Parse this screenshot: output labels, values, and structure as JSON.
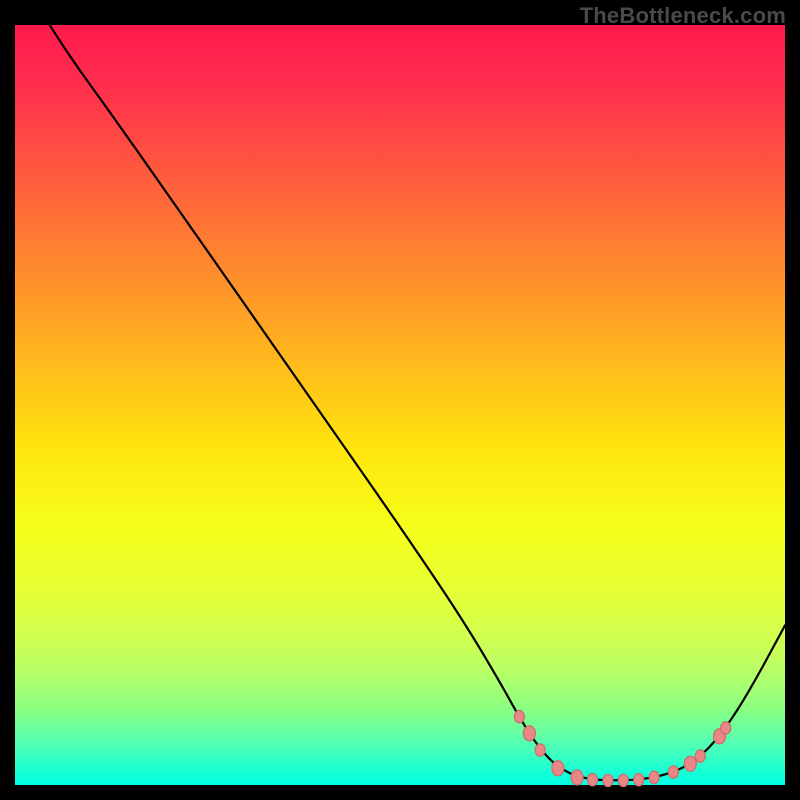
{
  "watermark": "TheBottleneck.com",
  "chart_data": {
    "type": "line",
    "title": "",
    "xlabel": "",
    "ylabel": "",
    "xlim": [
      0,
      100
    ],
    "ylim": [
      0,
      100
    ],
    "curve": [
      {
        "x": 4.5,
        "y": 100
      },
      {
        "x": 7.0,
        "y": 96
      },
      {
        "x": 12.0,
        "y": 89
      },
      {
        "x": 20.0,
        "y": 77.5
      },
      {
        "x": 30.0,
        "y": 63.0
      },
      {
        "x": 40.0,
        "y": 48.5
      },
      {
        "x": 50.0,
        "y": 34.0
      },
      {
        "x": 58.0,
        "y": 22.0
      },
      {
        "x": 63.0,
        "y": 13.5
      },
      {
        "x": 66.0,
        "y": 8.0
      },
      {
        "x": 69.0,
        "y": 3.6
      },
      {
        "x": 72.0,
        "y": 1.4
      },
      {
        "x": 75.0,
        "y": 0.7
      },
      {
        "x": 78.0,
        "y": 0.6
      },
      {
        "x": 81.0,
        "y": 0.7
      },
      {
        "x": 84.0,
        "y": 1.2
      },
      {
        "x": 87.0,
        "y": 2.3
      },
      {
        "x": 90.0,
        "y": 4.6
      },
      {
        "x": 93.0,
        "y": 8.5
      },
      {
        "x": 96.0,
        "y": 13.5
      },
      {
        "x": 100.0,
        "y": 21.0
      }
    ],
    "markers": [
      {
        "x": 65.5,
        "y": 9.0,
        "size": 5
      },
      {
        "x": 66.8,
        "y": 6.8,
        "size": 6
      },
      {
        "x": 68.2,
        "y": 4.6,
        "size": 5
      },
      {
        "x": 70.5,
        "y": 2.2,
        "size": 6
      },
      {
        "x": 73.0,
        "y": 1.0,
        "size": 6
      },
      {
        "x": 75.0,
        "y": 0.7,
        "size": 5
      },
      {
        "x": 77.0,
        "y": 0.6,
        "size": 5
      },
      {
        "x": 79.0,
        "y": 0.6,
        "size": 5
      },
      {
        "x": 81.0,
        "y": 0.7,
        "size": 5
      },
      {
        "x": 83.0,
        "y": 1.0,
        "size": 5
      },
      {
        "x": 85.5,
        "y": 1.7,
        "size": 5
      },
      {
        "x": 87.7,
        "y": 2.8,
        "size": 6
      },
      {
        "x": 89.0,
        "y": 3.8,
        "size": 5
      },
      {
        "x": 91.5,
        "y": 6.4,
        "size": 6
      },
      {
        "x": 92.3,
        "y": 7.5,
        "size": 5
      }
    ],
    "colors": {
      "curve": "#000000",
      "marker_fill": "#e98686",
      "marker_stroke": "#cc6b6b",
      "gradient_top": "#ff1a4d",
      "gradient_bottom": "#00ffe6"
    }
  }
}
